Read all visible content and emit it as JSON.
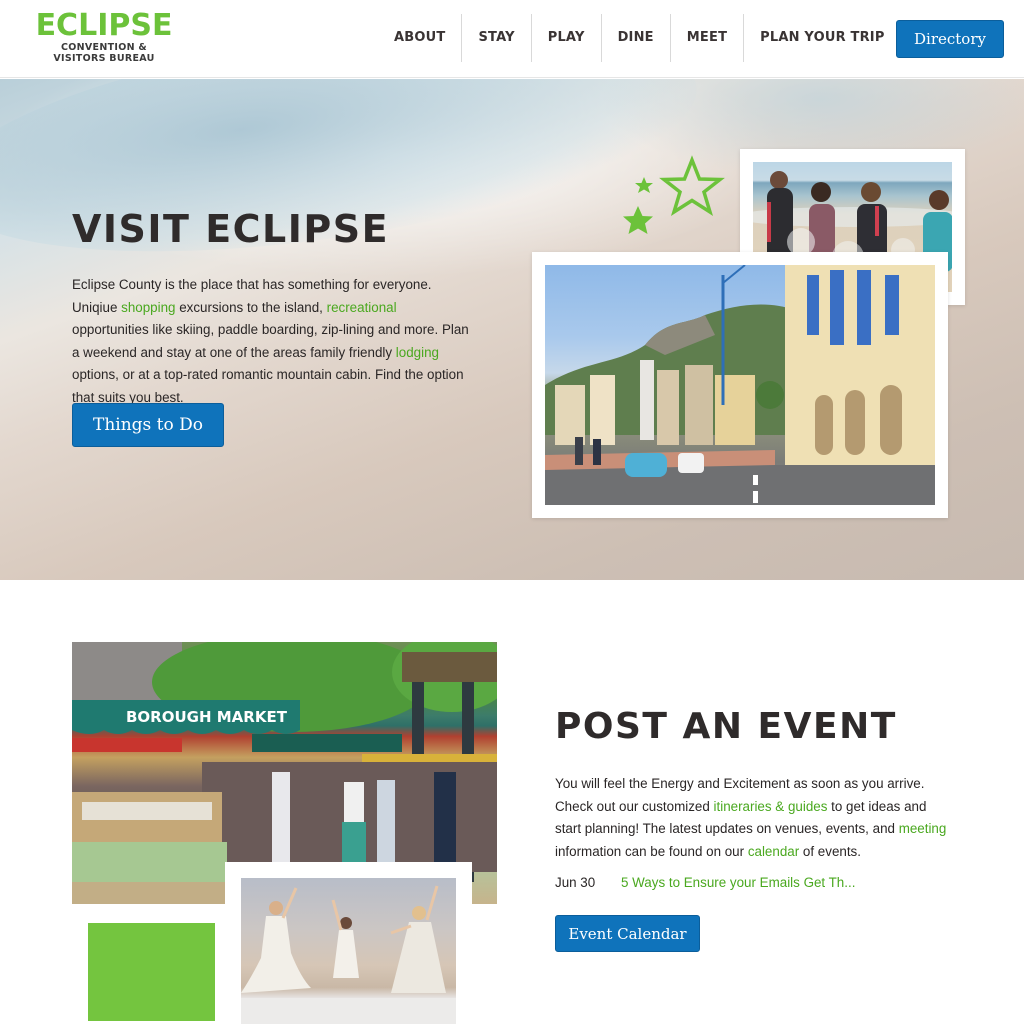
{
  "brand": {
    "name": "ECLIPSE",
    "subtitle_line1": "CONVENTION &",
    "subtitle_line2": "VISITORS BUREAU",
    "color": "#6cc23a"
  },
  "nav": {
    "items": [
      {
        "label": "ABOUT"
      },
      {
        "label": "STAY"
      },
      {
        "label": "PLAY"
      },
      {
        "label": "DINE"
      },
      {
        "label": "MEET"
      },
      {
        "label": "PLAN YOUR TRIP"
      }
    ],
    "directory_button": "Directory"
  },
  "hero": {
    "title": "VISIT ECLIPSE",
    "paragraph": [
      {
        "text": "Eclipse County is the place that has something for everyone. Uniqiue ",
        "link": false
      },
      {
        "text": "shopping",
        "link": true
      },
      {
        "text": " excursions to the island, ",
        "link": false
      },
      {
        "text": "recreational",
        "link": true
      },
      {
        "text": " opportunities like skiing, paddle boarding, zip-lining and more. Plan a weekend and stay at one of the areas family friendly ",
        "link": false
      },
      {
        "text": "lodging",
        "link": true
      },
      {
        "text": " options, or at a top-rated romantic mountain cabin. Find the option that suits you best.",
        "link": false
      }
    ],
    "button": "Things to Do",
    "images": [
      {
        "name": "family-beach-photo",
        "description": "family splashing at the beach"
      },
      {
        "name": "city-street-photo",
        "description": "seaside city street with mountains"
      }
    ]
  },
  "event_section": {
    "title": "POST AN EVENT",
    "paragraph": [
      {
        "text": "You will feel the Energy and Excitement as soon as you arrive. Check out our customized ",
        "link": false
      },
      {
        "text": "itineraries & guides",
        "link": true
      },
      {
        "text": " to get ideas and start planning! The latest updates on venues, events, and ",
        "link": false
      },
      {
        "text": "meeting",
        "link": true
      },
      {
        "text": " information can be found on our ",
        "link": false
      },
      {
        "text": "calendar",
        "link": true
      },
      {
        "text": " of events.",
        "link": false
      }
    ],
    "latest_event": {
      "date": "Jun 30",
      "title": "5 Ways to Ensure your Emails Get Th..."
    },
    "button": "Event Calendar",
    "images": [
      {
        "name": "market-photo",
        "sign_text": "BOROUGH MARKET"
      },
      {
        "name": "dancers-photo",
        "description": "dancers performing on stage"
      }
    ]
  },
  "colors": {
    "accent_green": "#74c53f",
    "link_green": "#4aa81f",
    "button_blue": "#0f73bb",
    "heading": "#2f2b2b"
  }
}
